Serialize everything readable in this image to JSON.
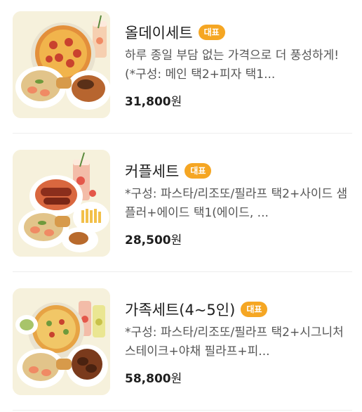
{
  "menu": {
    "items": [
      {
        "name": "올데이세트",
        "badge": "대표",
        "description": "하루 종일 부담 없는 가격으로 더 풍성하게! (*구성: 메인 택2+피자 택1...",
        "price": "31,800",
        "currency": "원",
        "thumbnail": "all-day-set-food-photo"
      },
      {
        "name": "커플세트",
        "badge": "대표",
        "description": "*구성: 파스타/리조또/필라프 택2+사이드 샘플러+에이드 택1(에이드, ...",
        "price": "28,500",
        "currency": "원",
        "thumbnail": "couple-set-food-photo"
      },
      {
        "name": "가족세트(4~5인)",
        "badge": "대표",
        "description": "*구성: 파스타/리조또/필라프 택2+시그니처 스테이크+야채 필라프+피...",
        "price": "58,800",
        "currency": "원",
        "thumbnail": "family-set-food-photo"
      }
    ]
  },
  "colors": {
    "badge_bg": "#f5a623",
    "thumb_bg": "#f6f1dc",
    "price_text": "#1e1e1e",
    "desc_text": "#555555"
  }
}
